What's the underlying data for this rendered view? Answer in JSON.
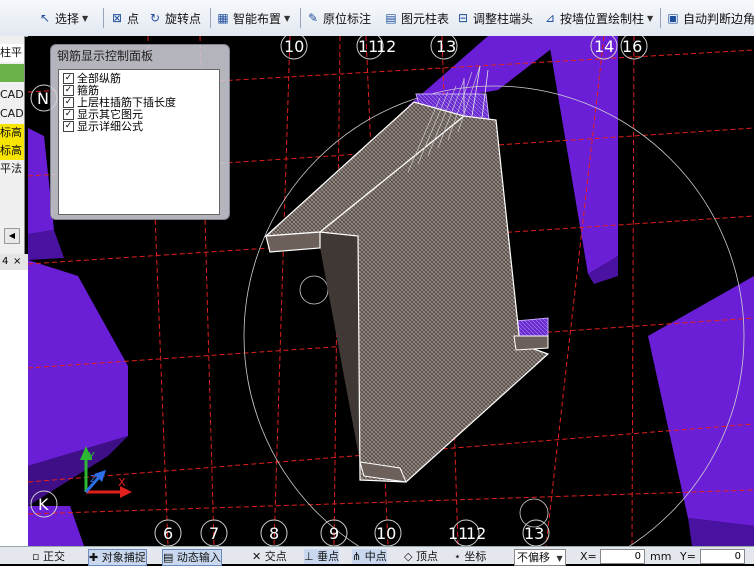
{
  "toolbar": {
    "select_label": "选择",
    "point_label": "点",
    "rotate_point_label": "旋转点",
    "smart_layout_label": "智能布置",
    "in_situ_label": "原位标注",
    "column_table_label": "图元柱表",
    "adjust_column_end_label": "调整柱端头",
    "wall_position_label": "按墙位置绘制柱",
    "auto_judge_label": "自动判断边角"
  },
  "left_panel": {
    "rows": [
      "柱平",
      "",
      "CAD",
      "CAD",
      "标高",
      "标高",
      "平法"
    ],
    "tab_label": "4",
    "tab_close": "×"
  },
  "rebar_panel": {
    "title": "钢筋显示控制面板",
    "options": [
      {
        "label": "全部纵筋",
        "checked": true
      },
      {
        "label": "箍筋",
        "checked": true
      },
      {
        "label": "上层柱插筋下插长度",
        "checked": true
      },
      {
        "label": "显示其它图元",
        "checked": true
      },
      {
        "label": "显示详细公式",
        "checked": true
      }
    ]
  },
  "grid_axes": {
    "top": [
      "10",
      "11",
      "12",
      "13",
      "14",
      "16"
    ],
    "bottom": [
      "6",
      "7",
      "8",
      "9",
      "10",
      "11",
      "12",
      "13"
    ],
    "left": [
      "N",
      "K"
    ]
  },
  "axis_gizmo": {
    "x": "X",
    "y": "Y",
    "z": "Z"
  },
  "statusbar": {
    "ortho_label": "正交",
    "object_snap_label": "对象捕捉",
    "dynamic_input_label": "动态输入",
    "intersection_label": "交点",
    "perpendicular_label": "垂点",
    "midpoint_label": "中点",
    "vertex_label": "顶点",
    "coordinate_label": "坐标",
    "offset_select": "不偏移",
    "x_label": "X=",
    "x_value": "0",
    "unit_label": "mm",
    "y_label": "Y=",
    "y_value": "0"
  },
  "colors": {
    "grid_line": "#e0201c",
    "purple_element": "#6a1fd6",
    "rebar_white": "#ffffff",
    "rebar_mesh": "#8c7f78"
  }
}
